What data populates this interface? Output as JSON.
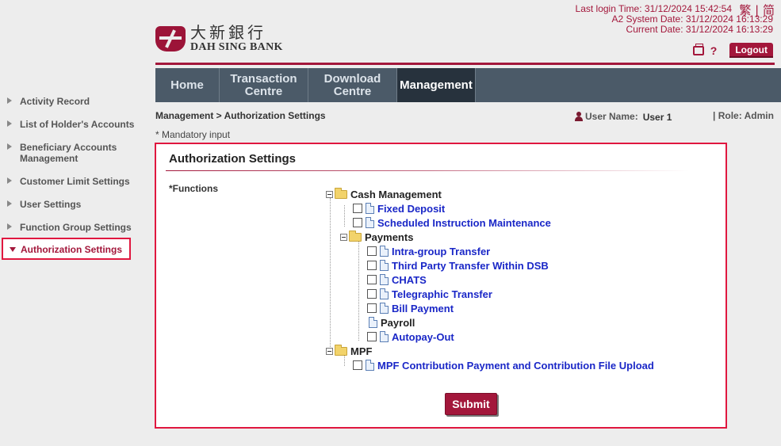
{
  "header": {
    "logo": {
      "chinese": "大新銀行",
      "english": "DAH SING BANK"
    },
    "last_login": "Last login Time: 31/12/2024 15:42:54",
    "system_date": "A2 System Date: 31/12/2024 16:13:29",
    "current_date": "Current Date: 31/12/2024 16:13:29",
    "language": {
      "traditional": "繁",
      "separator": "|",
      "simplified": "简"
    },
    "logout_label": "Logout",
    "help_label": "?"
  },
  "nav": {
    "items": [
      {
        "label": "Home"
      },
      {
        "label_line1": "Transaction",
        "label_line2": "Centre"
      },
      {
        "label_line1": "Download",
        "label_line2": "Centre"
      },
      {
        "label": "Management",
        "active": true
      }
    ]
  },
  "sidebar": {
    "items": [
      {
        "label": "Activity Record"
      },
      {
        "label": "List of Holder's Accounts"
      },
      {
        "label_line1": "Beneficiary Accounts",
        "label_line2": "Management"
      },
      {
        "label": "Customer Limit Settings"
      },
      {
        "label": "User Settings"
      },
      {
        "label": "Function Group Settings"
      },
      {
        "label": "Authorization Settings",
        "active": true
      }
    ]
  },
  "breadcrumb": "Management > Authorization Settings",
  "user": {
    "label": "User Name:",
    "value": "User 1",
    "role": "| Role: Admin"
  },
  "mandatory_note": "* Mandatory input",
  "panel": {
    "title": "Authorization Settings",
    "functions_label": "*Functions",
    "tree": {
      "cash_management": "Cash Management",
      "fixed_deposit": "Fixed Deposit",
      "scheduled_instruction": "Scheduled Instruction Maintenance",
      "payments": "Payments",
      "intra_group": "Intra-group Transfer",
      "third_party": "Third Party Transfer Within DSB",
      "chats": "CHATS",
      "telegraphic": "Telegraphic Transfer",
      "bill_payment": "Bill Payment",
      "payroll": "Payroll",
      "autopay_out": "Autopay-Out",
      "mpf": "MPF",
      "mpf_contribution": "MPF Contribution Payment and Contribution File Upload"
    },
    "submit_label": "Submit"
  },
  "colors": {
    "brand": "#a3173b",
    "nav_bg": "#4b5a68",
    "nav_active": "#27323d",
    "link": "#1a27c7",
    "highlight_border": "#e0173f"
  }
}
